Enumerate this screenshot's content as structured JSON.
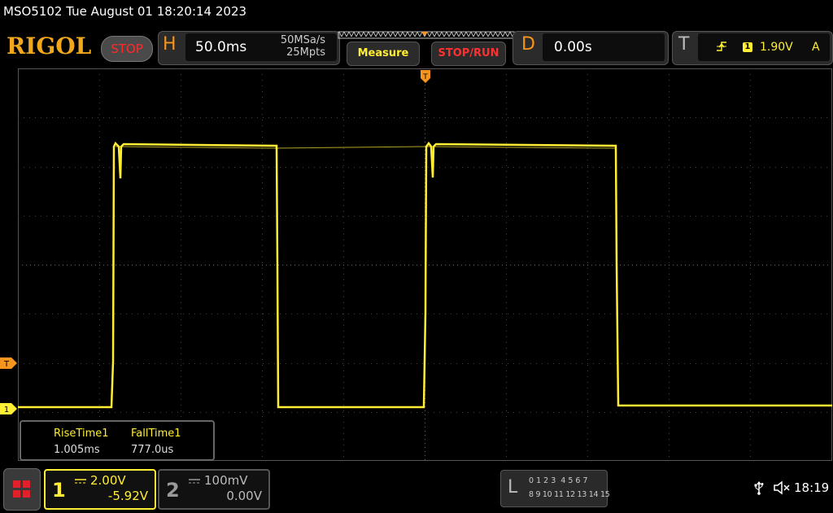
{
  "window": {
    "title": "MSO5102  Tue August 01 18:20:14 2023"
  },
  "brand": {
    "logo": "RIGOL",
    "run_state": "STOP"
  },
  "horizontal": {
    "label": "H",
    "timebase": "50.0ms",
    "sample_rate": "50MSa/s",
    "memory_depth": "25Mpts"
  },
  "toolbar": {
    "measure_label": "Measure",
    "stop_run_label": "STOP/RUN"
  },
  "delay": {
    "label": "D",
    "value": "0.00s"
  },
  "trigger": {
    "label": "T",
    "channel": "1",
    "level": "1.90V",
    "mode": "A",
    "marker_label": "T"
  },
  "channel_markers": {
    "ch1": "1"
  },
  "measurements": {
    "headers": [
      "RiseTime1",
      "FallTime1"
    ],
    "values": [
      "1.005ms",
      "777.0us"
    ]
  },
  "channels": {
    "ch1": {
      "number": "1",
      "scale": "2.00V",
      "offset": "-5.92V",
      "color": "#ffee33"
    },
    "ch2": {
      "number": "2",
      "scale": "100mV",
      "offset": "0.00V",
      "color": "#888888"
    }
  },
  "logic": {
    "label": "L",
    "row1": "0 1 2 3  4 5 6 7",
    "row2": "8 9 10 11 12 13 14 15"
  },
  "status": {
    "time": "18:19"
  }
}
